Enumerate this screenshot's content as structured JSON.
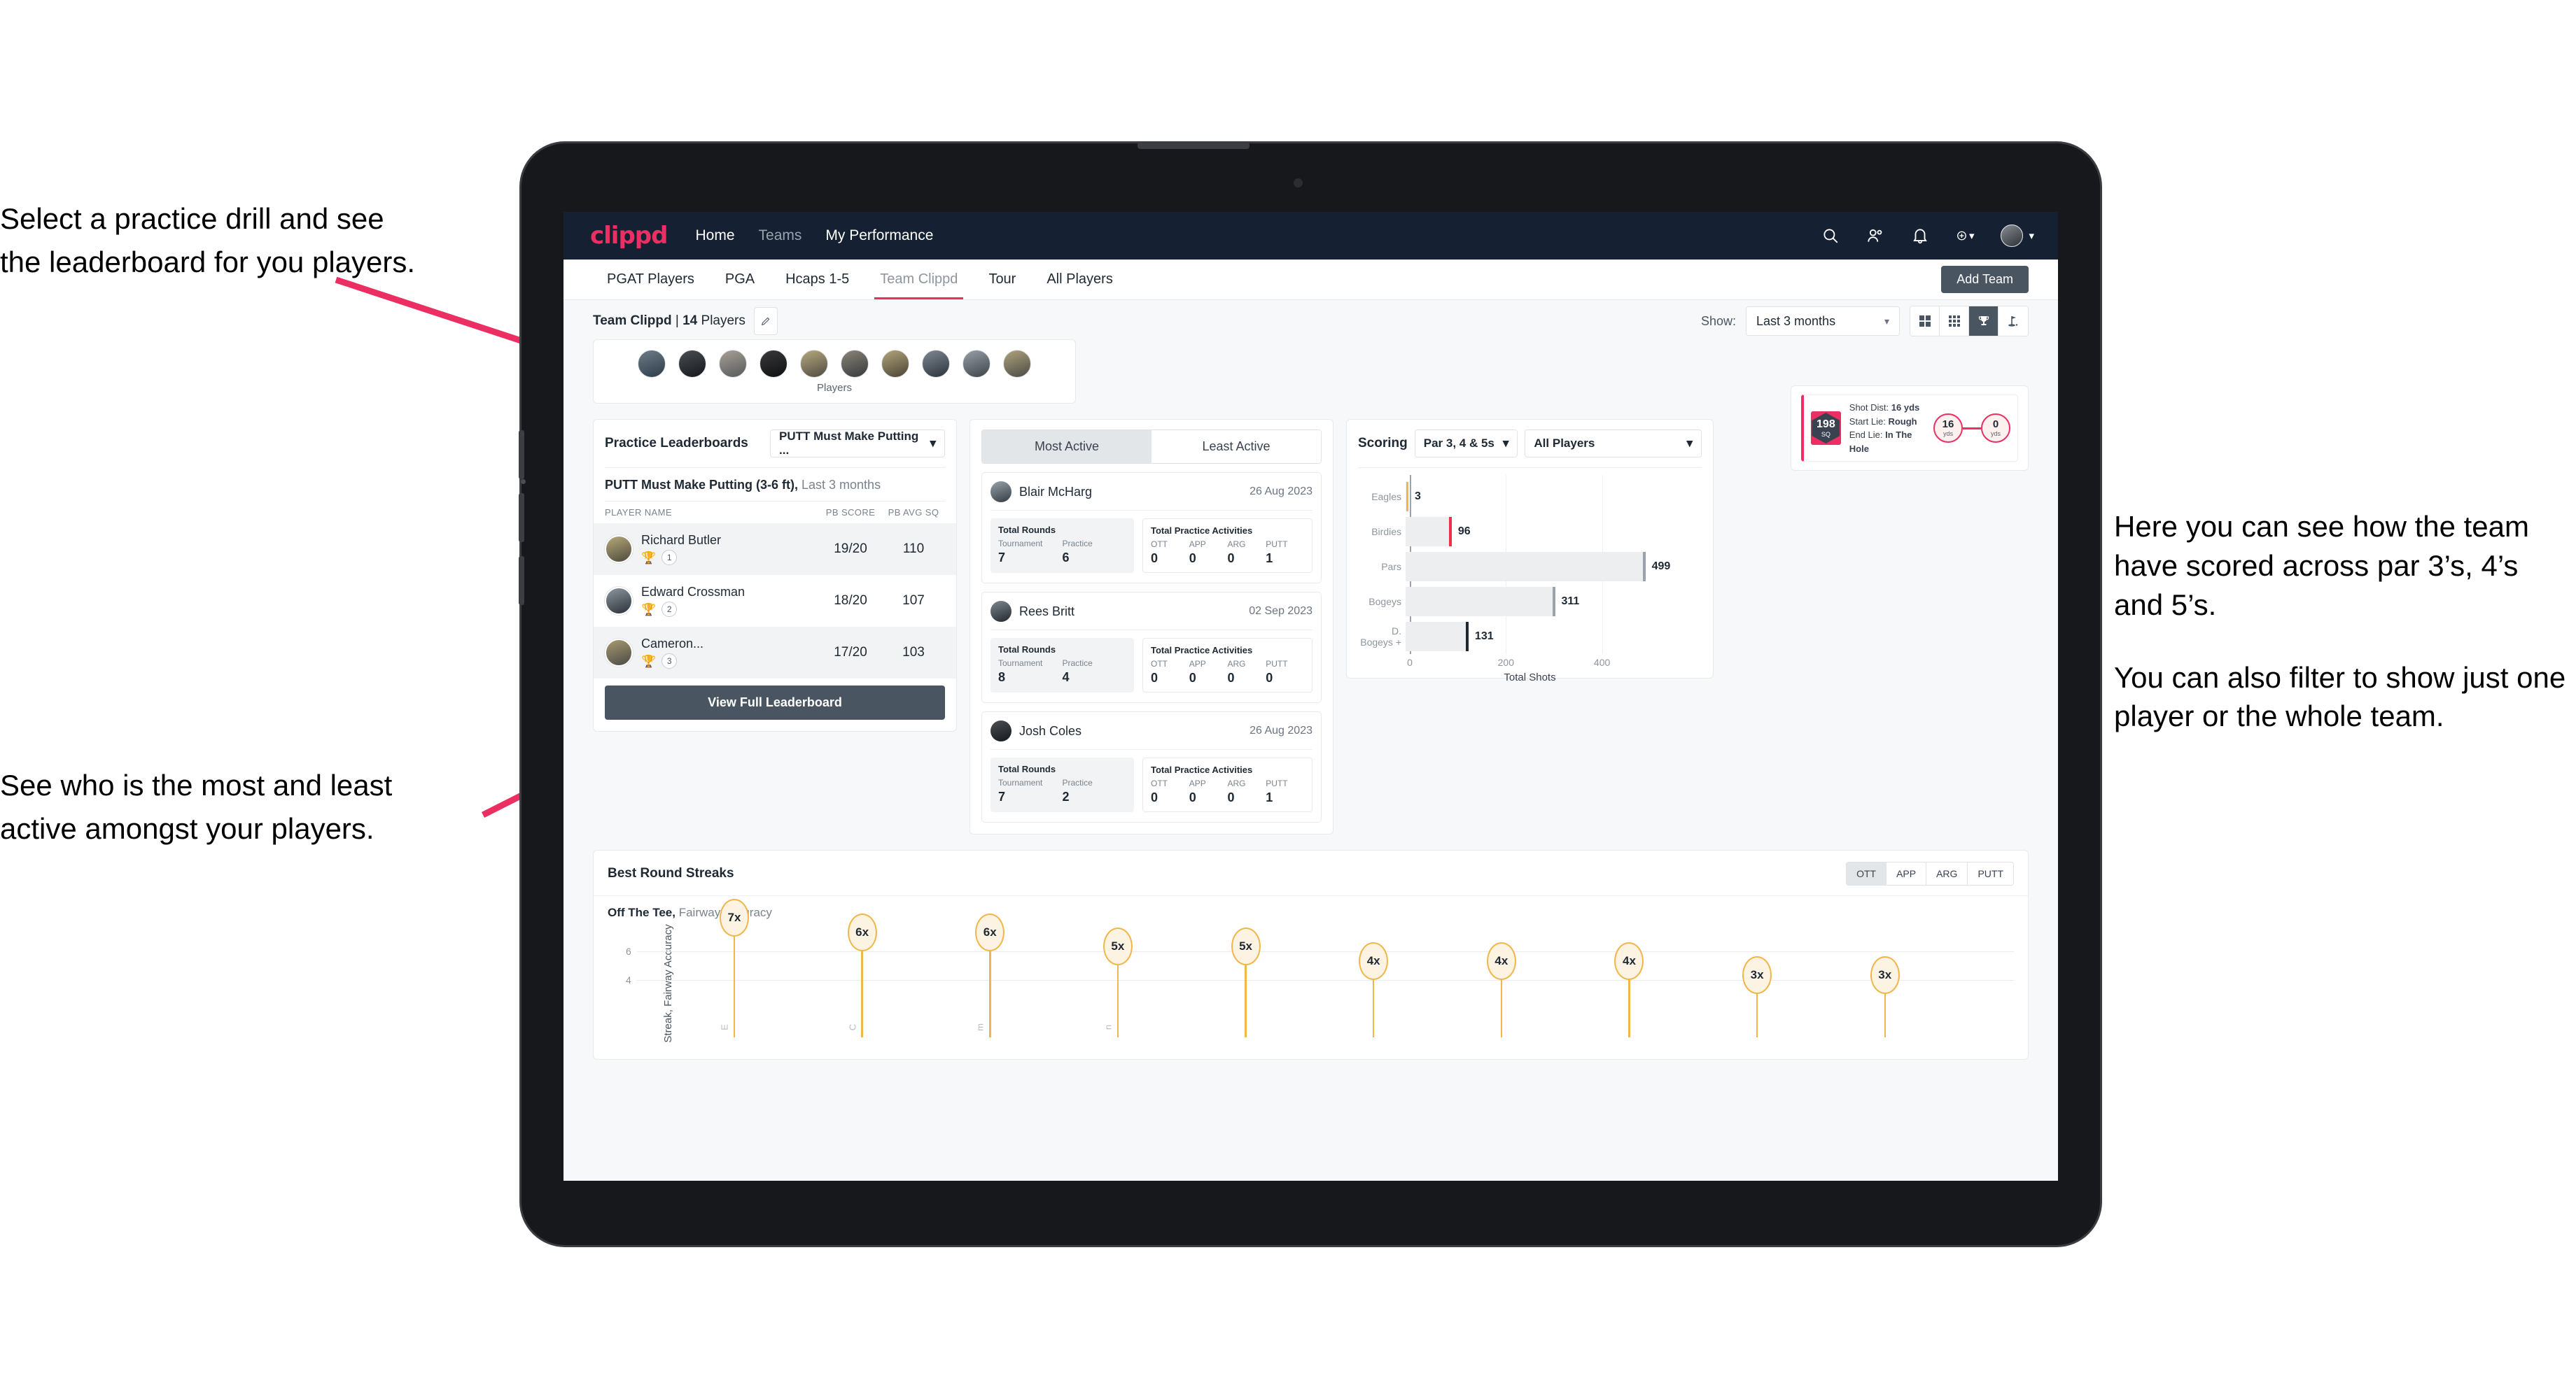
{
  "annotations": {
    "left_top": [
      "Select a practice drill and see",
      "the leaderboard for you players."
    ],
    "left_bottom": [
      "See who is the most and least",
      "active amongst your players."
    ],
    "right": [
      "Here you can see how the team have scored across par 3’s, 4’s and 5’s.",
      "You can also filter to show just one player or the whole team."
    ]
  },
  "navbar": {
    "brand": "clippd",
    "links": [
      {
        "label": "Home",
        "dim": false
      },
      {
        "label": "Teams",
        "dim": true
      },
      {
        "label": "My Performance",
        "dim": false
      }
    ],
    "icons": [
      "search-icon",
      "people-icon",
      "bell-icon",
      "plus-circle-icon"
    ]
  },
  "tabs": [
    {
      "label": "PGAT Players",
      "active": false
    },
    {
      "label": "PGA",
      "active": false
    },
    {
      "label": "Hcaps 1-5",
      "active": false
    },
    {
      "label": "Team Clippd",
      "active": true
    },
    {
      "label": "Tour",
      "active": false
    },
    {
      "label": "All Players",
      "active": false
    }
  ],
  "add_team_button": "Add Team",
  "toolbar": {
    "team_name": "Team Clippd",
    "separator": " | ",
    "player_count": "14",
    "players_word": " Players",
    "show_label": "Show:",
    "range_value": "Last 3 months",
    "view_buttons": [
      "grid-4-icon",
      "grid-9-icon",
      "trophy-icon",
      "golf-flag-icon"
    ],
    "active_view_index": 2
  },
  "avatar_strip": {
    "caption": "Players",
    "count": 10
  },
  "shot_card": {
    "score": "198",
    "score_unit": "SQ",
    "lines": [
      {
        "key": "Shot Dist:",
        "value": "16 yds"
      },
      {
        "key": "Start Lie:",
        "value": "Rough"
      },
      {
        "key": "End Lie:",
        "value": "In The Hole"
      }
    ],
    "start_dist": {
      "value": "16",
      "unit": "yds"
    },
    "end_dist": {
      "value": "0",
      "unit": "yds"
    }
  },
  "leaderboard": {
    "title": "Practice Leaderboards",
    "drill_select": "PUTT Must Make Putting ...",
    "subtitle_bold": "PUTT Must Make Putting (3-6 ft),",
    "subtitle_dim": " Last 3 months",
    "columns": [
      "PLAYER NAME",
      "PB SCORE",
      "PB AVG SQ"
    ],
    "rows": [
      {
        "name": "Richard Butler",
        "rank": "1",
        "trophy": "gold",
        "pb_score": "19/20",
        "pb_avg_sq": "110"
      },
      {
        "name": "Edward Crossman",
        "rank": "2",
        "trophy": "silver",
        "pb_score": "18/20",
        "pb_avg_sq": "107"
      },
      {
        "name": "Cameron...",
        "rank": "3",
        "trophy": "bronze",
        "pb_score": "17/20",
        "pb_avg_sq": "103"
      }
    ],
    "button": "View Full Leaderboard"
  },
  "activity": {
    "tabs": [
      {
        "label": "Most Active",
        "active": true
      },
      {
        "label": "Least Active",
        "active": false
      }
    ],
    "rounds_title": "Total Rounds",
    "rounds_keys": [
      "Tournament",
      "Practice"
    ],
    "practice_title": "Total Practice Activities",
    "practice_keys": [
      "OTT",
      "APP",
      "ARG",
      "PUTT"
    ],
    "cards": [
      {
        "name": "Blair McHarg",
        "date": "26 Aug 2023",
        "rounds": [
          "7",
          "6"
        ],
        "practice": [
          "0",
          "0",
          "0",
          "1"
        ]
      },
      {
        "name": "Rees Britt",
        "date": "02 Sep 2023",
        "rounds": [
          "8",
          "4"
        ],
        "practice": [
          "0",
          "0",
          "0",
          "0"
        ]
      },
      {
        "name": "Josh Coles",
        "date": "26 Aug 2023",
        "rounds": [
          "7",
          "2"
        ],
        "practice": [
          "0",
          "0",
          "0",
          "1"
        ]
      }
    ]
  },
  "scoring": {
    "title": "Scoring",
    "par_select": "Par 3, 4 & 5s",
    "player_select": "All Players"
  },
  "streaks": {
    "title": "Best Round Streaks",
    "seg": [
      {
        "label": "OTT",
        "active": true
      },
      {
        "label": "APP",
        "active": false
      },
      {
        "label": "ARG",
        "active": false
      },
      {
        "label": "PUTT",
        "active": false
      }
    ],
    "sub_bold": "Off The Tee,",
    "sub_dim": " Fairway Accuracy"
  },
  "chart_data": [
    {
      "type": "bar",
      "orientation": "horizontal",
      "title": "Scoring",
      "categories": [
        "Eagles",
        "Birdies",
        "Pars",
        "Bogeys",
        "D. Bogeys +"
      ],
      "values": [
        3,
        96,
        499,
        311,
        131
      ],
      "cap_colors": [
        "#f0b64a",
        "#e8334a",
        "#9aa3ad",
        "#9aa3ad",
        "#1f2933"
      ],
      "xlabel": "Total Shots",
      "ylabel": "",
      "xlim": [
        0,
        520
      ],
      "xticks": [
        0,
        200,
        400
      ],
      "grid": true,
      "legend": "none"
    },
    {
      "type": "scatter",
      "variant": "lollipop",
      "title": "Best Round Streaks",
      "subtitle": "Off The Tee, Fairway Accuracy",
      "ylabel": "Streak, Fairway Accuracy",
      "yticks": [
        4,
        6
      ],
      "ylim": [
        0,
        7.6
      ],
      "categories": [
        "E",
        "C",
        "m",
        "n",
        "",
        "",
        "",
        "",
        "",
        ""
      ],
      "values": [
        7,
        6,
        6,
        5,
        5,
        4,
        4,
        4,
        3,
        3
      ],
      "labels": [
        "7x",
        "6x",
        "6x",
        "5x",
        "5x",
        "4x",
        "4x",
        "4x",
        "3x",
        "3x"
      ],
      "grid": true,
      "legend": "none"
    }
  ]
}
